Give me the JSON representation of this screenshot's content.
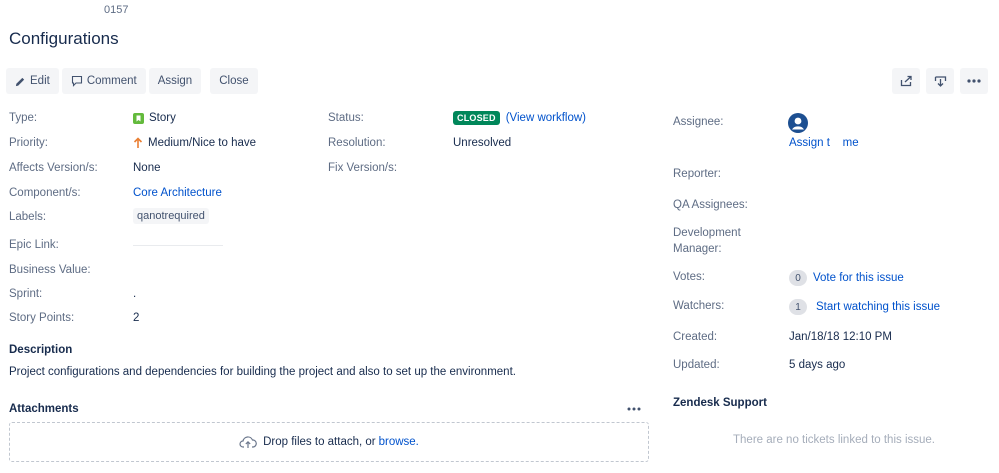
{
  "issue": {
    "key": "0157",
    "title": "Configurations"
  },
  "toolbar": {
    "edit": "Edit",
    "comment": "Comment",
    "assign": "Assign",
    "close": "Close",
    "share_icon": "share-icon",
    "export_icon": "export-icon",
    "more_icon": "more-icon"
  },
  "details": {
    "type_label": "Type:",
    "type_value": "Story",
    "priority_label": "Priority:",
    "priority_value": "Medium/Nice to have",
    "affects_label": "Affects Version/s:",
    "affects_value": "None",
    "component_label": "Component/s:",
    "component_value": "Core Architecture",
    "labels_label": "Labels:",
    "labels_value": "qanotrequired",
    "epic_label": "Epic Link:",
    "business_label": "Business Value:",
    "sprint_label": "Sprint:",
    "sprint_value": ".",
    "points_label": "Story Points:",
    "points_value": "2",
    "status_label": "Status:",
    "status_value": "CLOSED",
    "view_workflow": "(View workflow)",
    "resolution_label": "Resolution:",
    "resolution_value": "Unresolved",
    "fix_label": "Fix Version/s:"
  },
  "people": {
    "assignee_label": "Assignee:",
    "assign_to_me": "Assign t    me",
    "reporter_label": "Reporter:",
    "qa_label": "QA Assignees:",
    "dev_manager_label_1": "Development",
    "dev_manager_label_2": "Manager:",
    "votes_label": "Votes:",
    "votes_count": "0",
    "vote_link": "Vote for this issue",
    "watchers_label": "Watchers:",
    "watchers_count": "1",
    "watch_link": "Start watching this issue"
  },
  "dates": {
    "created_label": "Created:",
    "created_value": "Jan/18/18 12:10 PM",
    "updated_label": "Updated:",
    "updated_value": "5 days ago"
  },
  "description": {
    "heading": "Description",
    "text": "Project configurations and dependencies for building the project and also to set up the environment."
  },
  "attachments": {
    "heading": "Attachments",
    "drop_text": "Drop files to attach, or ",
    "browse": "browse."
  },
  "zendesk": {
    "heading": "Zendesk Support",
    "empty": "There are no tickets linked to this issue."
  },
  "colors": {
    "link": "#0052cc",
    "closed_lozenge": "#00875a",
    "story_icon": "#63ba3c",
    "priority_arrow": "#e97f33"
  }
}
